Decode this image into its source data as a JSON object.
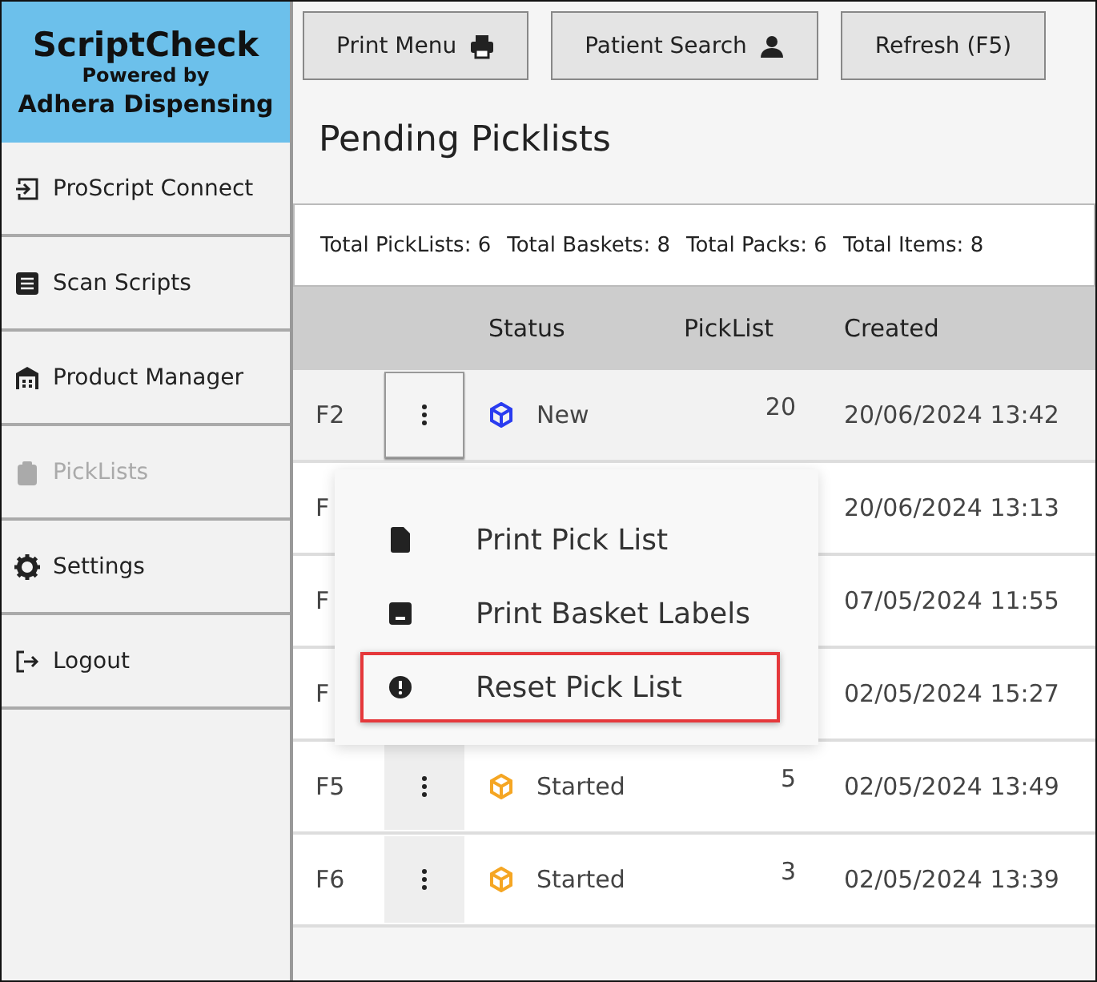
{
  "brand": {
    "title": "ScriptCheck",
    "subtitle": "Powered by",
    "company": "Adhera Dispensing"
  },
  "sidebar": {
    "items": [
      {
        "label": "ProScript Connect",
        "disabled": false
      },
      {
        "label": "Scan Scripts",
        "disabled": false
      },
      {
        "label": "Product Manager",
        "disabled": false
      },
      {
        "label": "PickLists",
        "disabled": true
      },
      {
        "label": "Settings",
        "disabled": false
      },
      {
        "label": "Logout",
        "disabled": false
      }
    ]
  },
  "toolbar": {
    "buttons": [
      {
        "label": "Print Menu"
      },
      {
        "label": "Patient Search"
      },
      {
        "label": "Refresh (F5)"
      }
    ]
  },
  "page_title": "Pending Picklists",
  "summary": [
    "Total PickLists: 6",
    "Total Baskets: 8",
    "Total Packs: 6",
    "Total Items: 8"
  ],
  "table": {
    "columns": [
      "Status",
      "PickList",
      "Created"
    ],
    "rows": [
      {
        "key": "F2",
        "status": "New",
        "kind": "new",
        "picklist": "20",
        "created": "20/06/2024 13:42",
        "menu_open": true
      },
      {
        "key": "F",
        "created": "20/06/2024 13:13",
        "menu_open": false
      },
      {
        "key": "F",
        "created": "07/05/2024 11:55",
        "menu_open": false
      },
      {
        "key": "F",
        "created": "02/05/2024 15:27",
        "menu_open": false
      },
      {
        "key": "F5",
        "status": "Started",
        "kind": "started",
        "picklist": "5",
        "created": "02/05/2024 13:49",
        "menu_open": false
      },
      {
        "key": "F6",
        "status": "Started",
        "kind": "started",
        "picklist": "3",
        "created": "02/05/2024 13:39",
        "menu_open": false
      }
    ]
  },
  "context_menu": {
    "items": [
      {
        "label": "Print Pick List",
        "selected": false
      },
      {
        "label": "Print Basket Labels",
        "selected": false
      },
      {
        "label": "Reset Pick List",
        "selected": true
      }
    ]
  }
}
